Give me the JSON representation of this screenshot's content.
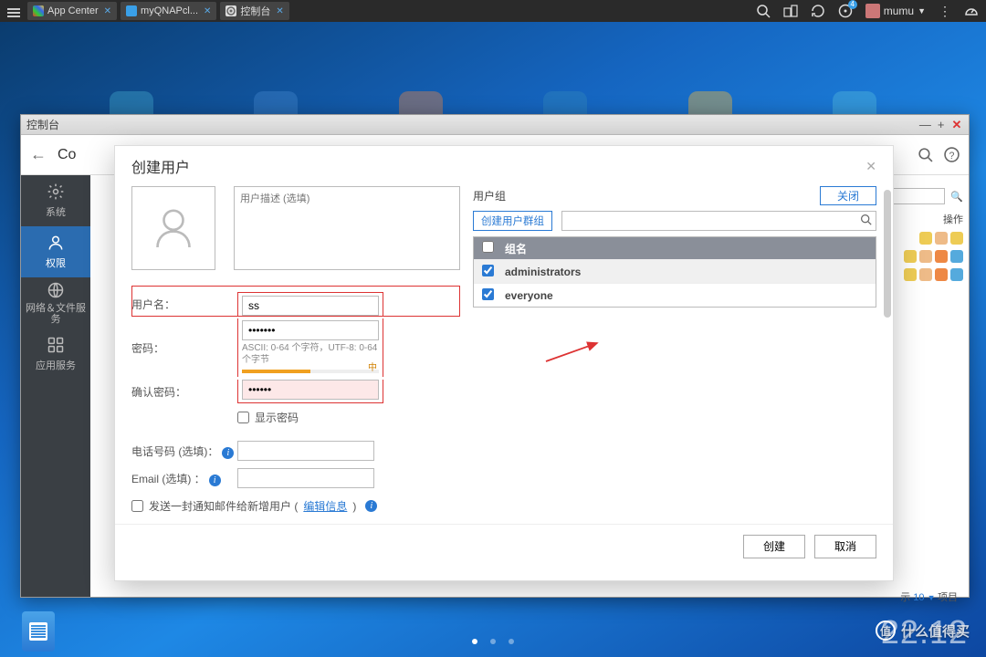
{
  "topbar": {
    "tabs": [
      {
        "label": "App Center",
        "color": "#e67e22"
      },
      {
        "label": "myQNAPcl...",
        "color": "#3aa0e8"
      },
      {
        "label": "控制台",
        "color": "#ddd"
      }
    ],
    "user": "mumu",
    "notif_count": "4"
  },
  "window": {
    "title": "控制台",
    "back_label": "Co",
    "sidebar": [
      {
        "label": "系统"
      },
      {
        "label": "权限"
      },
      {
        "label": "网络＆文件服务"
      },
      {
        "label": "应用服务"
      }
    ],
    "sidebar_active_index": 1,
    "behind": {
      "ops_label": "操作",
      "footer_show": "示",
      "footer_num": "10",
      "footer_items": "项目"
    }
  },
  "modal": {
    "title": "创建用户",
    "desc_placeholder": "用户描述 (选填)",
    "labels": {
      "username": "用户名：",
      "password": "密码：",
      "confirm": "确认密码：",
      "show_pwd": "显示密码",
      "phone": "电话号码 (选填)：",
      "email": "Email (选填) ：",
      "notify": "发送一封通知邮件给新增用户 (",
      "edit_info": "编辑信息",
      "notify_close": ")"
    },
    "values": {
      "username": "ss",
      "password": "•••••••",
      "confirm": "••••••"
    },
    "hint": "ASCII: 0-64 个字符，UTF-8: 0-64 个字节",
    "strength_label": "中",
    "right": {
      "title": "用户组",
      "close": "关闭",
      "create_group": "创建用户群组",
      "col_name": "组名",
      "groups": [
        {
          "name": "administrators",
          "checked": true
        },
        {
          "name": "everyone",
          "checked": true
        }
      ]
    },
    "buttons": {
      "create": "创建",
      "cancel": "取消"
    }
  },
  "clock": "22.12",
  "watermark": "什么值得买"
}
